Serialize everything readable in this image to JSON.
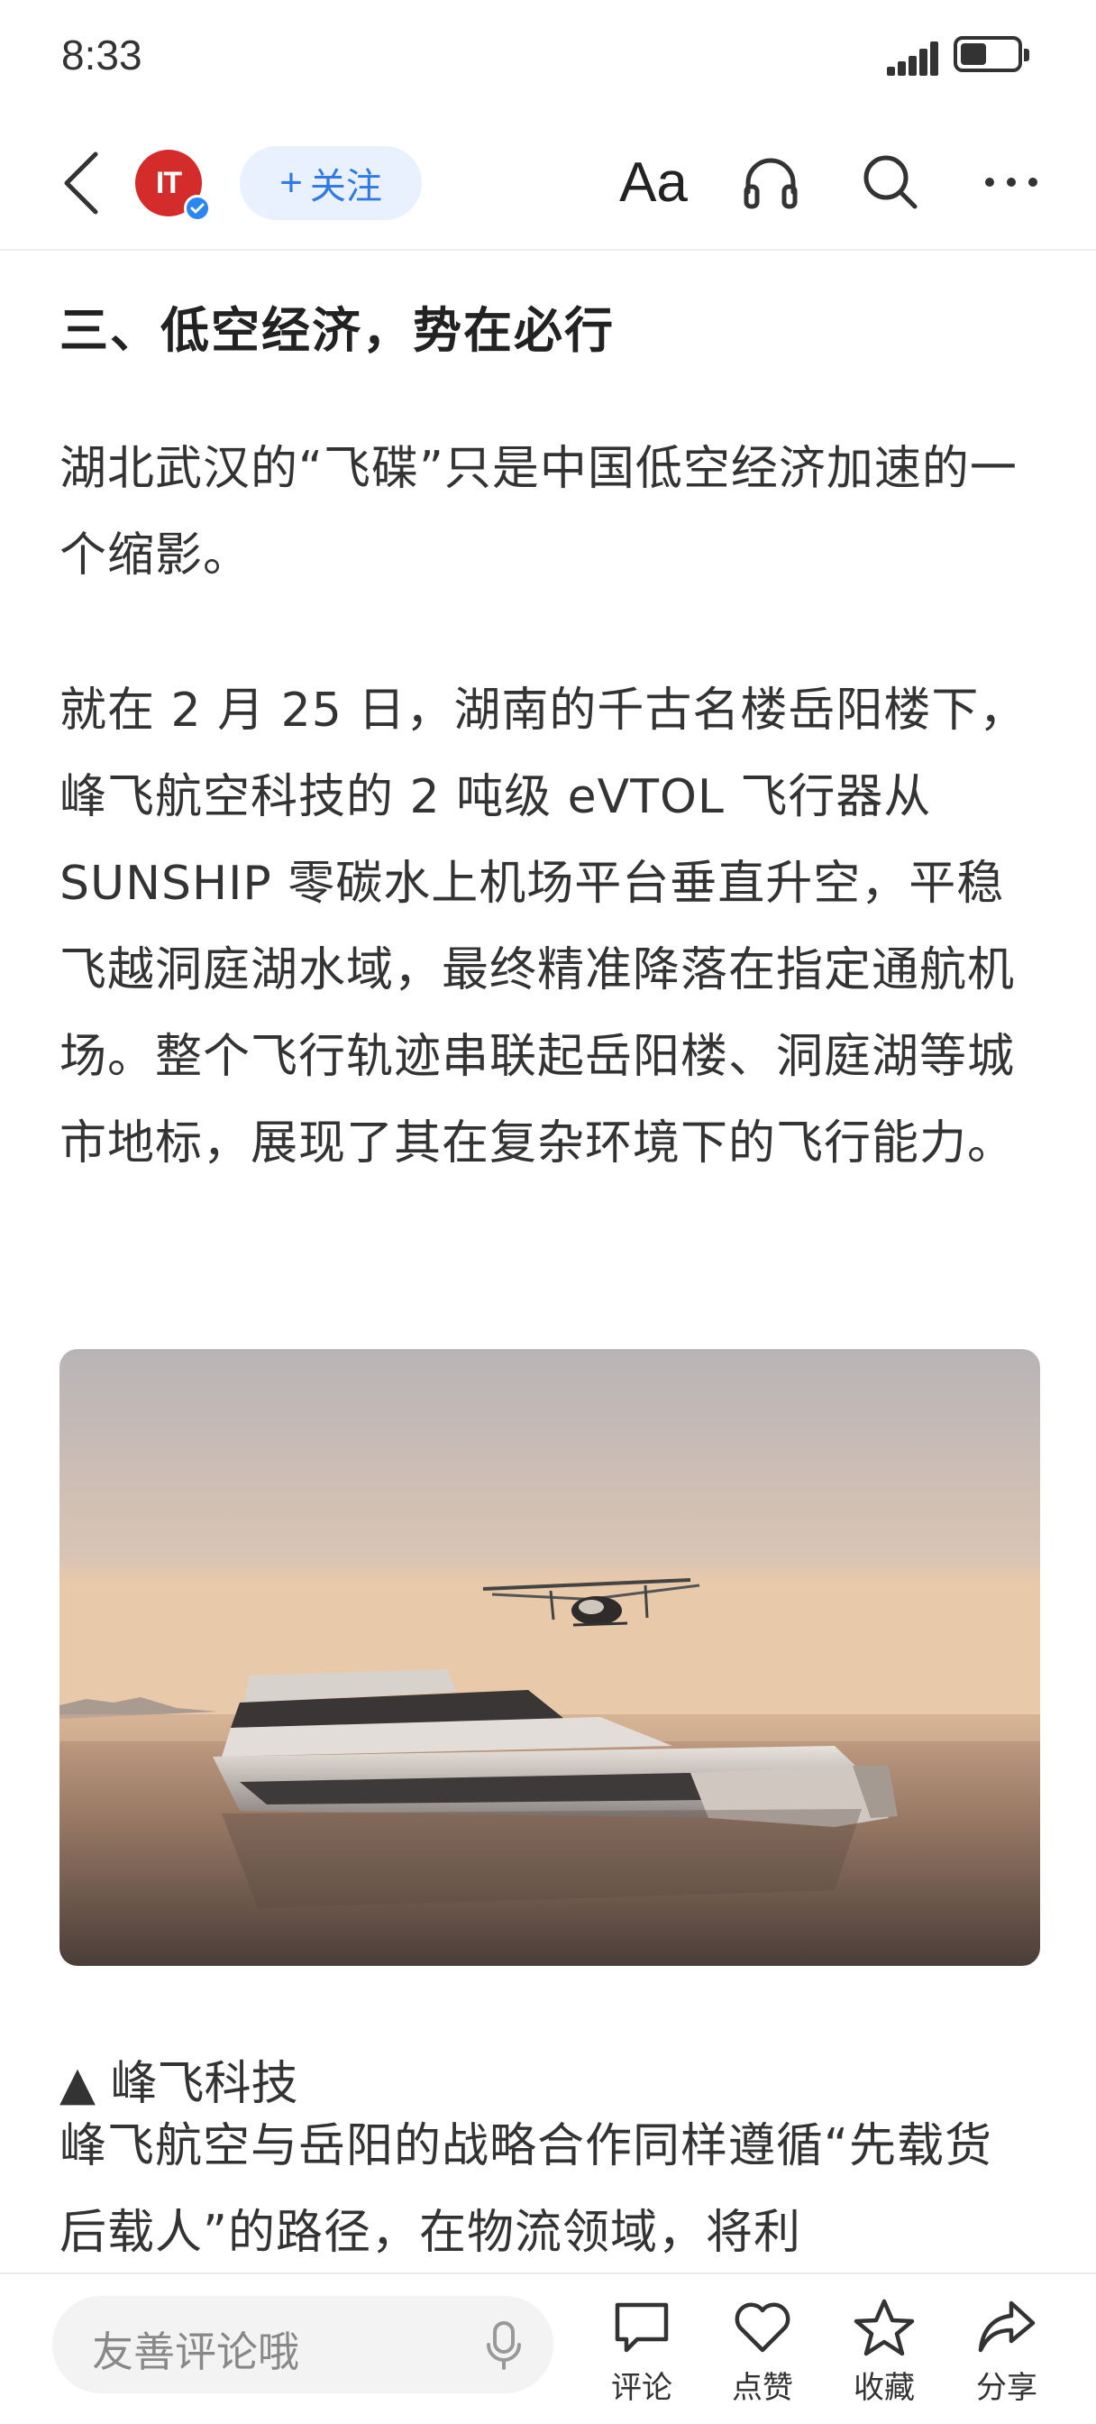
{
  "status_bar": {
    "time": "8:33",
    "signal_icon": "signal-bars-icon",
    "battery_icon": "battery-icon",
    "battery_level": 0.4
  },
  "header": {
    "back_icon": "chevron-left-icon",
    "avatar_text": "IT",
    "verified_icon": "verified-check-icon",
    "follow_plus": "+",
    "follow_label": "关注",
    "font_size_label": "Aa",
    "listen_icon": "headphones-icon",
    "search_icon": "search-icon",
    "more_icon": "more-dots-icon"
  },
  "article": {
    "section_heading": "三、低空经济，势在必行",
    "paragraphs": [
      "湖北武汉的“飞碟”只是中国低空经济加速的一个缩影。",
      "就在 2 月 25 日，湖南的千古名楼岳阳楼下，峰飞航空科技的 2 吨级 eVTOL 飞行器从 SUNSHIP 零碳水上机场平台垂直升空，平稳飞越洞庭湖水域，最终精准降落在指定通航机场。整个飞行轨迹串联起岳阳楼、洞庭湖等城市地标，展现了其在复杂环境下的飞行能力。",
      "峰飞航空与岳阳的战略合作同样遵循“先载货后载人”的路径，在物流领域，将利"
    ],
    "caption": "▲ 峰飞科技"
  },
  "bottom_bar": {
    "comment_placeholder": "友善评论哦",
    "mic_icon": "microphone-icon",
    "actions": [
      {
        "label": "评论",
        "icon": "comment-icon"
      },
      {
        "label": "点赞",
        "icon": "heart-icon"
      },
      {
        "label": "收藏",
        "icon": "star-icon"
      },
      {
        "label": "分享",
        "icon": "share-icon"
      }
    ]
  },
  "colors": {
    "accent": "#2f7ae5",
    "follow_bg": "#e8f1fd",
    "avatar_red": "#d42b2b",
    "verified_blue": "#2a86f2",
    "text": "#333333"
  }
}
